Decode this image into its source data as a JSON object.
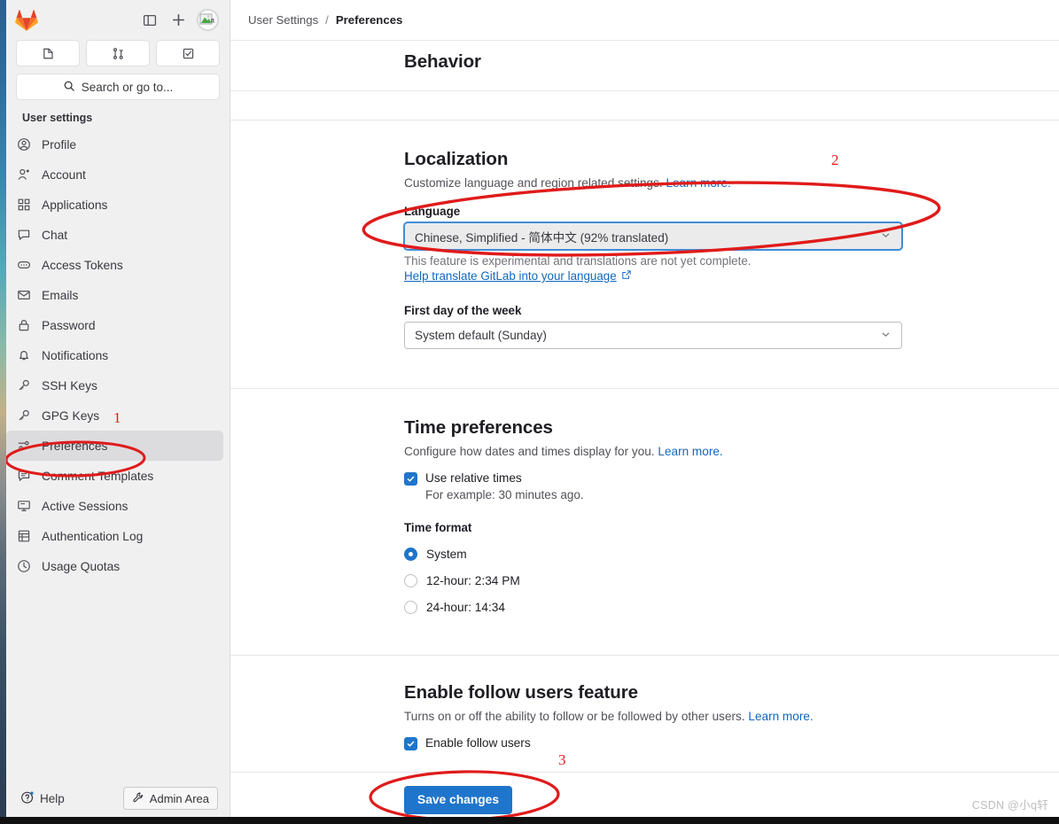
{
  "window": {
    "brand": "gitlab-logo"
  },
  "sidebar": {
    "toolbar": {
      "toggle_sidebar_icon": "panel-toggle-icon",
      "new_icon": "plus-icon",
      "avatar_icon": "broken-image-avatar"
    },
    "quick_buttons": [
      {
        "name": "issues",
        "icon": "issue-icon"
      },
      {
        "name": "merge-requests",
        "icon": "merge-request-icon"
      },
      {
        "name": "todos",
        "icon": "todo-check-icon"
      }
    ],
    "search": {
      "placeholder": "Search or go to...",
      "icon": "search-icon"
    },
    "section_title": "User settings",
    "items": [
      {
        "label": "Profile",
        "icon": "user-circle-icon",
        "active": false
      },
      {
        "label": "Account",
        "icon": "user-star-icon",
        "active": false
      },
      {
        "label": "Applications",
        "icon": "grid-apps-icon",
        "active": false
      },
      {
        "label": "Chat",
        "icon": "chat-bubble-icon",
        "active": false
      },
      {
        "label": "Access Tokens",
        "icon": "token-icon",
        "active": false
      },
      {
        "label": "Emails",
        "icon": "envelope-icon",
        "active": false
      },
      {
        "label": "Password",
        "icon": "lock-icon",
        "active": false
      },
      {
        "label": "Notifications",
        "icon": "bell-icon",
        "active": false
      },
      {
        "label": "SSH Keys",
        "icon": "key-icon",
        "active": false
      },
      {
        "label": "GPG Keys",
        "icon": "key-icon",
        "active": false
      },
      {
        "label": "Preferences",
        "icon": "preferences-sliders-icon",
        "active": true
      },
      {
        "label": "Comment Templates",
        "icon": "comment-lines-icon",
        "active": false
      },
      {
        "label": "Active Sessions",
        "icon": "monitor-icon",
        "active": false
      },
      {
        "label": "Authentication Log",
        "icon": "log-list-icon",
        "active": false
      },
      {
        "label": "Usage Quotas",
        "icon": "gauge-icon",
        "active": false
      }
    ],
    "footer": {
      "help_label": "Help",
      "help_icon": "question-circle-icon",
      "admin_label": "Admin Area",
      "admin_icon": "wrench-icon"
    }
  },
  "breadcrumb": {
    "parent": "User Settings",
    "separator": "/",
    "current": "Preferences"
  },
  "main": {
    "behavior": {
      "title": "Behavior"
    },
    "localization": {
      "title": "Localization",
      "desc": "Customize language and region related settings.",
      "desc_link": "Learn more.",
      "language_label": "Language",
      "language_value": "Chinese, Simplified - 简体中文 (92% translated)",
      "language_hint": "This feature is experimental and translations are not yet complete.",
      "translate_link": "Help translate GitLab into your language",
      "translate_link_icon": "external-link-icon",
      "first_day_label": "First day of the week",
      "first_day_value": "System default (Sunday)",
      "caret_icon": "chevron-down-icon"
    },
    "time_preferences": {
      "title": "Time preferences",
      "desc": "Configure how dates and times display for you.",
      "desc_link": "Learn more.",
      "relative_times_label": "Use relative times",
      "relative_times_sub": "For example: 30 minutes ago.",
      "relative_times_checked": true,
      "time_format_label": "Time format",
      "options": [
        {
          "label": "System",
          "selected": true
        },
        {
          "label": "12-hour: 2:34 PM",
          "selected": false
        },
        {
          "label": "24-hour: 14:34",
          "selected": false
        }
      ]
    },
    "follow_users": {
      "title": "Enable follow users feature",
      "desc": "Turns on or off the ability to follow or be followed by other users.",
      "desc_link": "Learn more.",
      "checkbox_label": "Enable follow users",
      "checkbox_checked": true
    },
    "save_button": "Save changes"
  },
  "annotations": {
    "color": "#e01b1b",
    "markers": [
      {
        "number": "1",
        "target": "preferences-sidebar-item"
      },
      {
        "number": "2",
        "target": "language-select"
      },
      {
        "number": "3",
        "target": "save-changes-button"
      }
    ]
  },
  "watermark": "CSDN @小q轩"
}
